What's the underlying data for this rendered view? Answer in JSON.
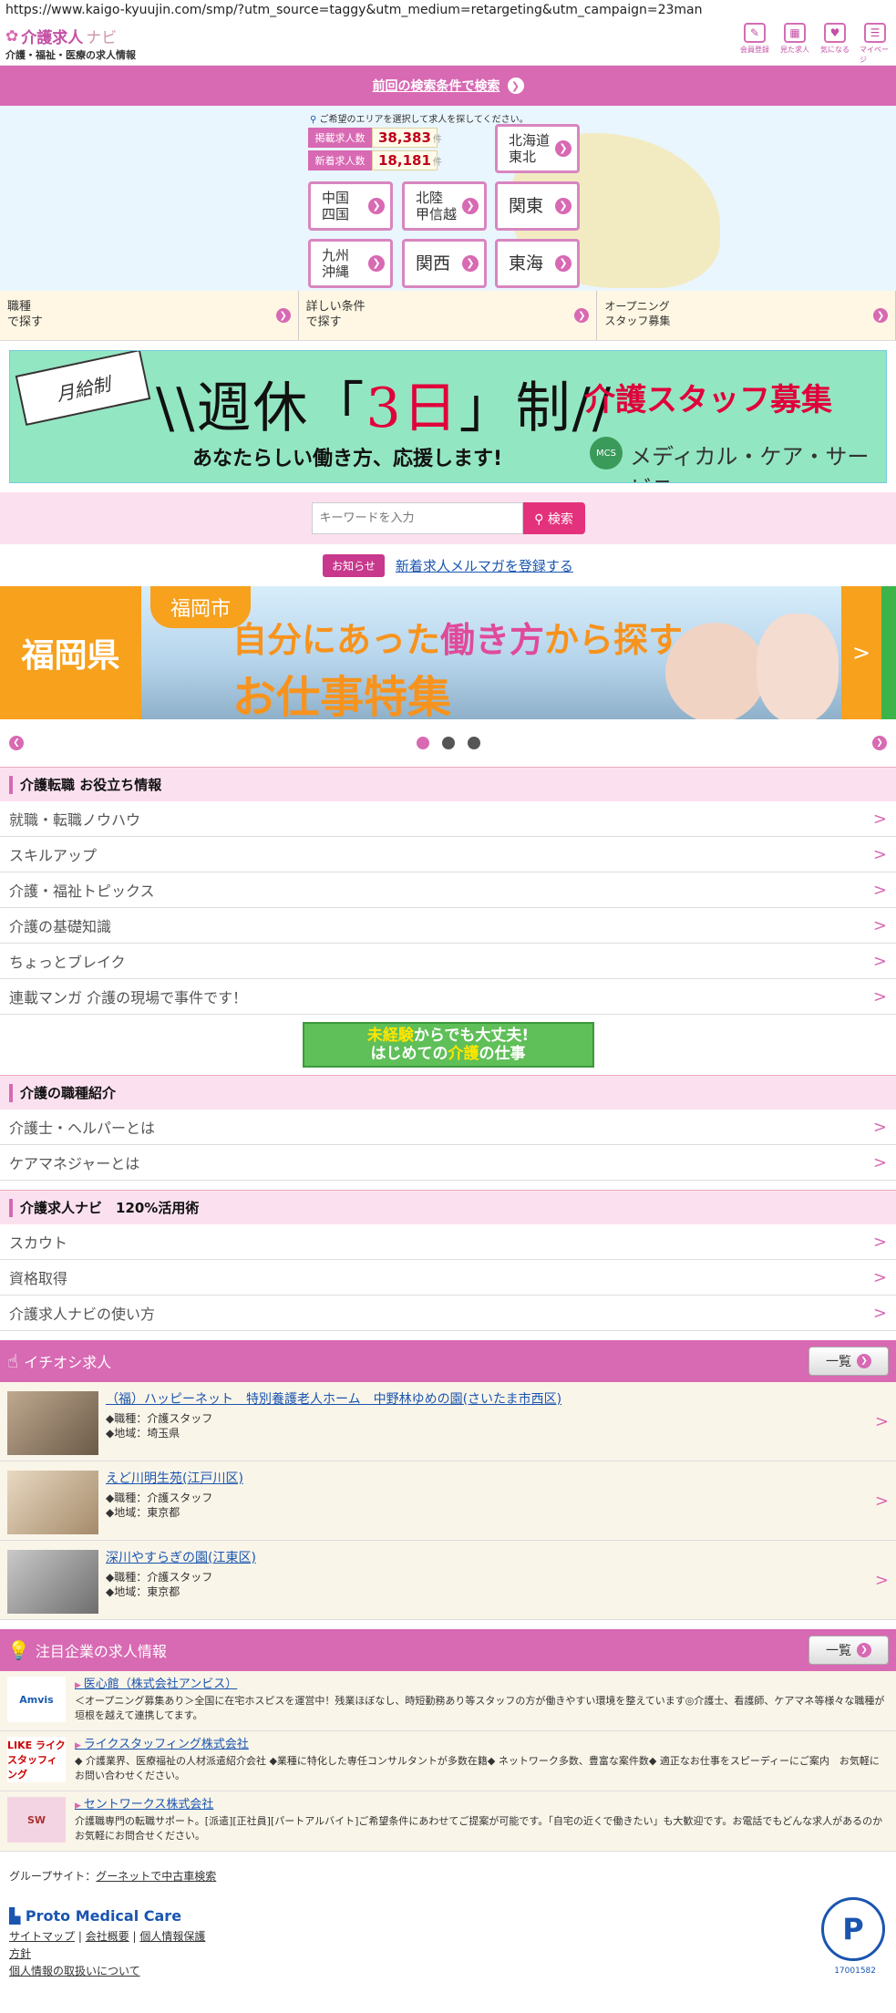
{
  "browser": {
    "url": "https://www.kaigo-kyuujin.com/smp/?utm_source=taggy&utm_medium=retargeting&utm_campaign=23man"
  },
  "header": {
    "logo_main": "介護求人",
    "logo_nav": "ナビ",
    "logo_sub": "介護・福祉・医療の求人情報",
    "icons": [
      {
        "label": "会員登録",
        "icon": "pencil-icon"
      },
      {
        "label": "見た求人",
        "icon": "calendar-icon"
      },
      {
        "label": "気になる",
        "icon": "heart-icon"
      },
      {
        "label": "マイページ",
        "icon": "mypage-icon"
      }
    ]
  },
  "prev_search": {
    "label": "前回の検索条件で検索"
  },
  "area": {
    "note": "ご希望のエリアを選択して求人を探してください。",
    "count_total_label": "掲載求人数",
    "count_total": "38,383",
    "count_new_label": "新着求人数",
    "count_new": "18,181",
    "unit": "件",
    "regions": [
      {
        "line1": "北海道",
        "line2": "東北"
      },
      {
        "line1": "中国",
        "line2": "四国"
      },
      {
        "line1": "北陸",
        "line2": "甲信越"
      },
      {
        "line1": "関東",
        "line2": ""
      },
      {
        "line1": "九州",
        "line2": "沖縄"
      },
      {
        "line1": "関西",
        "line2": ""
      },
      {
        "line1": "東海",
        "line2": ""
      }
    ]
  },
  "conditions": [
    {
      "line1": "職種",
      "line2": "で探す"
    },
    {
      "line1": "詳しい条件",
      "line2": "で探す"
    },
    {
      "line1": "オープニング",
      "line2": "スタッフ募集"
    }
  ],
  "banner1": {
    "ribbon": "月給制",
    "main_a": "週休「",
    "main_b": "3日",
    "main_c": "」制",
    "sub": "あなたらしい働き方、応援します!",
    "right": "介護スタッフ募集",
    "logo": "MCS",
    "company": "メディカル・ケア・サービス"
  },
  "search": {
    "placeholder": "キーワードを入力",
    "button": "検索"
  },
  "notice": {
    "tag": "お知らせ",
    "link": "新着求人メルマガを登録する"
  },
  "banner2": {
    "pref": "福岡県",
    "city": "福岡市",
    "line1_a": "自分にあった",
    "line1_b": "働き方",
    "line1_c": "から探す",
    "line2": "お仕事特集",
    "next": ">"
  },
  "sections": {
    "useful": {
      "title": "介護転職 お役立ち情報",
      "items": [
        "就職・転職ノウハウ",
        "スキルアップ",
        "介護・福祉トピックス",
        "介護の基礎知識",
        "ちょっとブレイク",
        "連載マンガ 介護の現場で事件です！"
      ]
    },
    "mid_banner": {
      "line1_a": "未経験",
      "line1_b": "からでも大丈夫!",
      "line2_a": "はじめての",
      "line2_b": "介護",
      "line2_c": "の仕事"
    },
    "jobs_intro": {
      "title": "介護の職種紹介",
      "items": [
        "介護士・ヘルパーとは",
        "ケアマネジャーとは"
      ]
    },
    "usage": {
      "title": "介護求人ナビ　120%活用術",
      "items": [
        "スカウト",
        "資格取得",
        "介護求人ナビの使い方"
      ]
    }
  },
  "pickup": {
    "title": "イチオシ求人",
    "list_button": "一覧",
    "jobs": [
      {
        "name": "（福）ハッピーネット　特別養護老人ホーム　中野林ゆめの園(さいたま市西区)",
        "type": "◆職種：介護スタッフ",
        "area": "◆地域：埼玉県"
      },
      {
        "name": "えど川明生苑(江戸川区)",
        "type": "◆職種：介護スタッフ",
        "area": "◆地域：東京都"
      },
      {
        "name": "深川やすらぎの園(江東区)",
        "type": "◆職種：介護スタッフ",
        "area": "◆地域：東京都"
      }
    ]
  },
  "featured": {
    "title": "注目企業の求人情報",
    "list_button": "一覧",
    "companies": [
      {
        "logo": "Amvis",
        "name": "医心館（株式会社アンビス）",
        "desc": "＜オープニング募集あり＞全国に在宅ホスピスを運営中！残業ほぼなし、時短勤務あり等スタッフの方が働きやすい環境を整えています◎介護士、看護師、ケアマネ等様々な職種が垣根を越えて連携してます。"
      },
      {
        "logo": "LIKE ライクスタッフィング",
        "name": "ライクスタッフィング株式会社",
        "desc": "◆ 介護業界、医療福祉の人材派遣紹介会社 ◆業種に特化した専任コンサルタントが多数在籍◆ ネットワーク多数、豊富な案件数◆ 適正なお仕事をスピーディーにご案内　お気軽にお問い合わせください。"
      },
      {
        "logo": "SW",
        "name": "セントワークス株式会社",
        "desc": "介護職専門の転職サポート。[派遣][正社員][パートアルバイト]ご希望条件にあわせてご提案が可能です。「自宅の近くで働きたい」も大歓迎です。お電話でもどんな求人があるのかお気軽にお問合せください。"
      }
    ]
  },
  "footer": {
    "group_label": "グループサイト：",
    "group_link": "グーネットで中古車検索",
    "brand": "Proto Medical Care",
    "links": [
      "サイトマップ",
      "会社概要",
      "個人情報保護",
      "方針",
      "個人情報の取扱いについて"
    ],
    "pmark_num": "17001582"
  }
}
